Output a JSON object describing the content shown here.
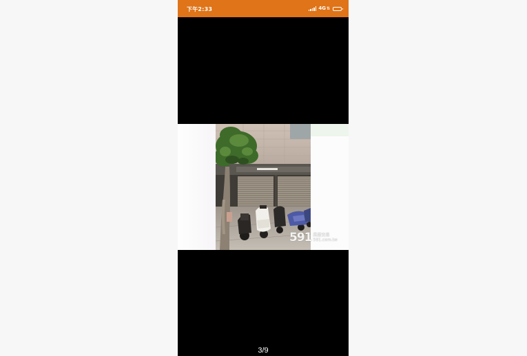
{
  "status_bar": {
    "time": "下午2:33",
    "network": "4G",
    "background_color": "#df7418"
  },
  "viewer": {
    "background_color": "#000000",
    "pager": "3/9",
    "photo": {
      "subject": "building-facade-with-parked-scooters",
      "watermark_number": "591",
      "watermark_text_line1": "房屋交易",
      "watermark_text_line2": "591.com.tw"
    }
  }
}
